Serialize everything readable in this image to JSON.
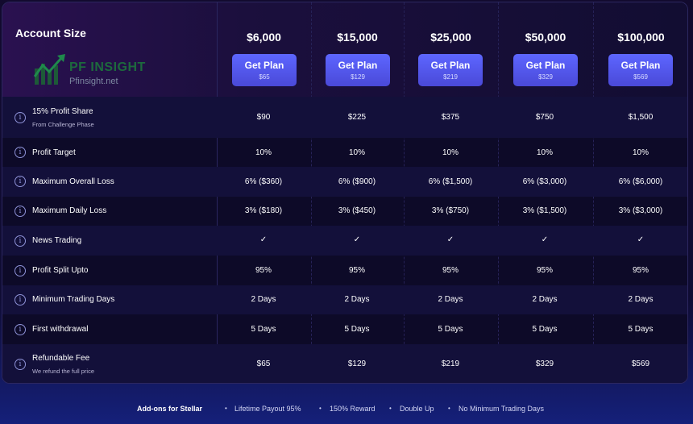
{
  "header": {
    "title": "Account Size",
    "logo": {
      "name": "PF INSIGHT",
      "url": "Pfinsight.net"
    }
  },
  "plans": [
    {
      "price": "$6,000",
      "button_label": "Get Plan",
      "button_fee": "$65"
    },
    {
      "price": "$15,000",
      "button_label": "Get Plan",
      "button_fee": "$129"
    },
    {
      "price": "$25,000",
      "button_label": "Get Plan",
      "button_fee": "$219"
    },
    {
      "price": "$50,000",
      "button_label": "Get Plan",
      "button_fee": "$329"
    },
    {
      "price": "$100,000",
      "button_label": "Get Plan",
      "button_fee": "$569"
    }
  ],
  "rows": [
    {
      "label": "15% Profit Share",
      "sublabel": "From Challenge Phase",
      "values": [
        "$90",
        "$225",
        "$375",
        "$750",
        "$1,500"
      ]
    },
    {
      "label": "Profit Target",
      "values": [
        "10%",
        "10%",
        "10%",
        "10%",
        "10%"
      ]
    },
    {
      "label": "Maximum Overall Loss",
      "values": [
        "6% ($360)",
        "6% ($900)",
        "6% ($1,500)",
        "6% ($3,000)",
        "6% ($6,000)"
      ]
    },
    {
      "label": "Maximum Daily Loss",
      "values": [
        "3% ($180)",
        "3% ($450)",
        "3% ($750)",
        "3% ($1,500)",
        "3% ($3,000)"
      ]
    },
    {
      "label": "News Trading",
      "values": [
        "✓",
        "✓",
        "✓",
        "✓",
        "✓"
      ]
    },
    {
      "label": "Profit Split Upto",
      "values": [
        "95%",
        "95%",
        "95%",
        "95%",
        "95%"
      ]
    },
    {
      "label": "Minimum Trading Days",
      "values": [
        "2 Days",
        "2 Days",
        "2 Days",
        "2 Days",
        "2 Days"
      ]
    },
    {
      "label": "First withdrawal",
      "values": [
        "5 Days",
        "5 Days",
        "5 Days",
        "5 Days",
        "5 Days"
      ]
    },
    {
      "label": "Refundable Fee",
      "sublabel": "We refund the full price",
      "values": [
        "$65",
        "$129",
        "$219",
        "$329",
        "$569"
      ]
    }
  ],
  "footer": {
    "title": "Add-ons for Stellar",
    "items": [
      "Lifetime Payout 95%",
      "150% Reward",
      "Double Up",
      "No Minimum Trading Days"
    ]
  },
  "colors": {
    "accent": "#5d66ff",
    "logo_green": "#1d6a3d",
    "background": "#0d0a28"
  },
  "icons": {
    "info": "info-circle-icon",
    "check": "checkmark-icon",
    "logo": "chart-arrow-icon"
  }
}
